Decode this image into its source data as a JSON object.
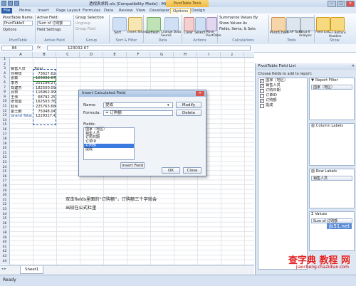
{
  "titlebar": {
    "title": "透视表求和.xls [Compatibility Mode] - Microsoft Excel",
    "context_tools": "PivotTable Tools"
  },
  "tabs": [
    "File",
    "Home",
    "Insert",
    "Page Layout",
    "Formulas",
    "Data",
    "Review",
    "View",
    "Developer",
    "Options",
    "Design"
  ],
  "ribbon": {
    "pivottable_name_label": "PivotTable Name:",
    "pivottable_name_value": "PivotTable5",
    "options_label": "Options",
    "active_field_label": "Active Field:",
    "active_field_value": "Sum of 订购额",
    "field_settings_label": "Field Settings",
    "group_selection": "Group Selection",
    "ungroup": "Ungroup",
    "group_field": "Group Field",
    "sort_label": "Sort",
    "insert_slicer": "Insert Slicer",
    "refresh": "Refresh",
    "change_data_source": "Change Data Source",
    "clear": "Clear",
    "select": "Select",
    "move_pivottable": "Move PivotTable",
    "summarize_values_by": "Summarize Values By",
    "show_values_as": "Show Values As",
    "fields_items_sets": "Fields, Items, & Sets",
    "pivotchart": "PivotChart",
    "olap_tools": "OLAP Tools",
    "what_if_analysis": "What-If Analysis",
    "field_list": "Field List",
    "buttons_headers": "+/- Buttons Headers",
    "groups": [
      "PivotTable",
      "Active Field",
      "Group",
      "Sort & Filter",
      "Data",
      "Actions",
      "Calculations",
      "Tools",
      "Show"
    ]
  },
  "formula_bar": {
    "name_box": "B6",
    "fx": "fx",
    "value": "123032.67"
  },
  "columns": [
    "A",
    "B",
    "C",
    "D",
    "E",
    "F",
    "G",
    "H",
    "I",
    "J"
  ],
  "rows": [
    "1",
    "2",
    "3",
    "4",
    "5",
    "6",
    "7",
    "8",
    "9",
    "10",
    "11",
    "12",
    "13",
    "14",
    "15",
    "16",
    "17",
    "18",
    "19",
    "20",
    "21",
    "22",
    "23",
    "24",
    "25",
    "26",
    "27",
    "28",
    "29",
    "30",
    "31",
    "32",
    "33",
    "34",
    "35",
    "36",
    "37",
    "38",
    "39",
    "40",
    "41",
    "42",
    "43",
    "44"
  ],
  "pivot": {
    "header_a": "销售人员",
    "header_b": "Total",
    "rows": [
      {
        "name": "刘英玫",
        "value": "73627.62"
      },
      {
        "name": "张颖",
        "value": "123032.67"
      },
      {
        "name": "李芳",
        "value": "201196.27"
      },
      {
        "name": "郑建杰",
        "value": "182500.09"
      },
      {
        "name": "孙林",
        "value": "116962.99"
      },
      {
        "name": "王伟",
        "value": "68792.25"
      },
      {
        "name": "张雪眉",
        "value": "162503.78"
      },
      {
        "name": "赵军",
        "value": "225763.68"
      },
      {
        "name": "金士鹏",
        "value": "75048.04"
      }
    ],
    "grand_total_label": "Grand Total",
    "grand_total_value": "1229327.4"
  },
  "annotation": {
    "line1": "双击fields里面的“订购额”，订购额三个字就会",
    "line2": "出现在公式栏里"
  },
  "sheet_tab": "Sheet1",
  "status": "Ready",
  "dialog": {
    "title": "Insert Calculated Field",
    "name_label": "Name:",
    "name_value": "提成",
    "formula_label": "Formula:",
    "formula_value": "= 订购额",
    "modify_btn": "Modify",
    "delete_btn": "Delete",
    "fields_label": "Fields:",
    "fields": [
      "国家（地区）",
      "销售人员",
      "订购日期",
      "订单ID",
      "订购额",
      "提成"
    ],
    "selected_field": "订购额",
    "insert_field_btn": "Insert Field",
    "ok_btn": "OK",
    "close_btn": "Close"
  },
  "field_list": {
    "title": "PivotTable Field List",
    "choose_label": "Choose fields to add to report:",
    "fields": [
      {
        "label": "国家（地区）",
        "checked": true
      },
      {
        "label": "销售人员",
        "checked": true
      },
      {
        "label": "订购日期",
        "checked": false
      },
      {
        "label": "订单ID",
        "checked": false
      },
      {
        "label": "订购额",
        "checked": true
      },
      {
        "label": "提成",
        "checked": false
      }
    ],
    "report_filter_label": "Report Filter",
    "report_filter_item": "国家（地区）",
    "column_labels_label": "Column Labels",
    "row_labels_label": "Row Labels",
    "row_labels_item": "销售人员",
    "values_label": "Values",
    "values_item": "Sum of 订购额"
  },
  "watermark": {
    "text": "查字典 教程 网",
    "url": "jiaocheng.chazidian.com",
    "site": "jb51.net"
  },
  "colors": {
    "accent": "#2a5fa8",
    "context": "#f0b945",
    "selection": "#3b7be0"
  }
}
